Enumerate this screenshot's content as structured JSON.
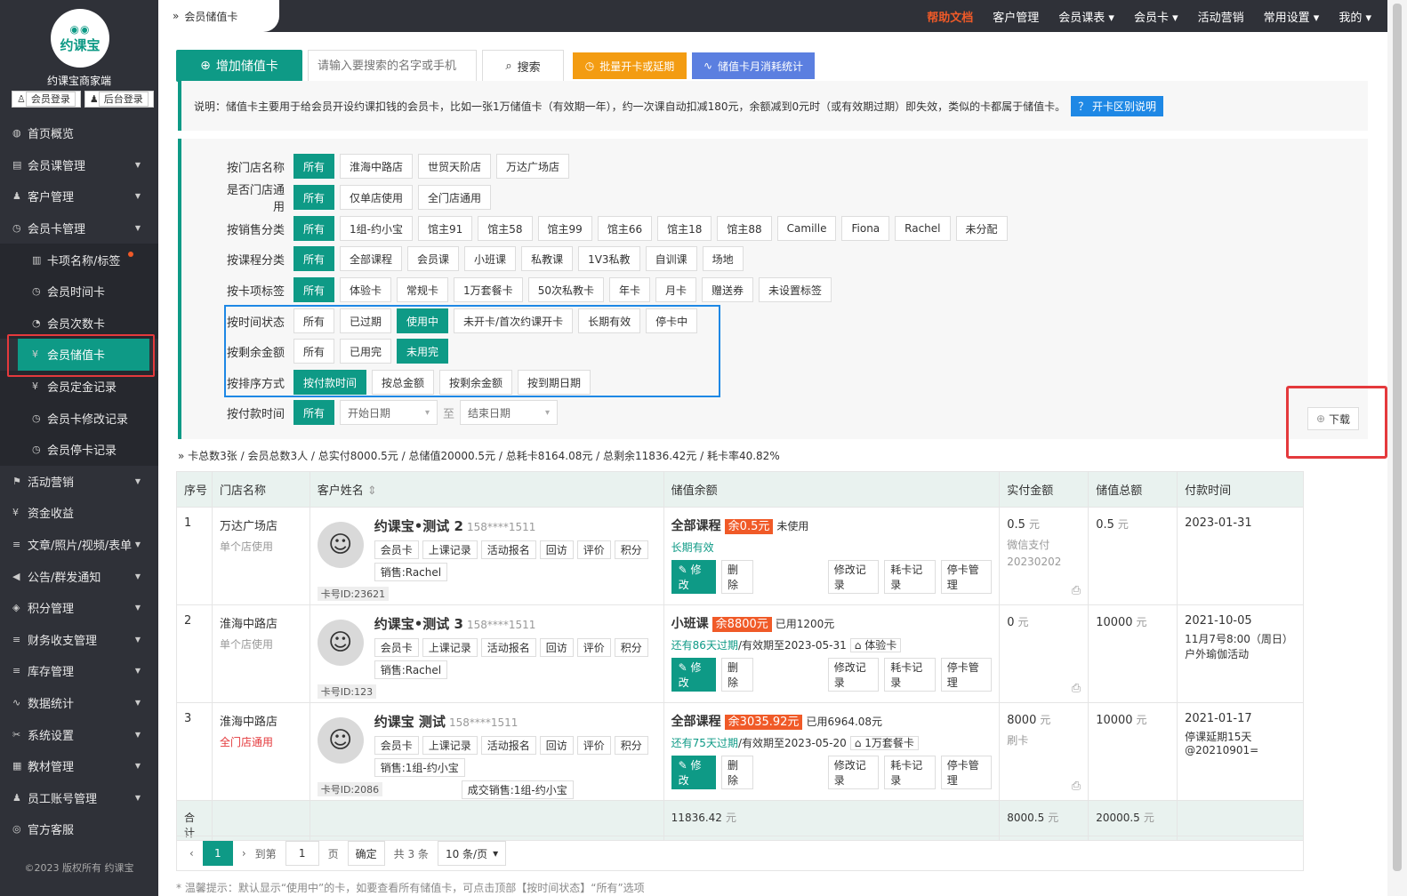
{
  "sidebar": {
    "logo": "约课宝",
    "brand": "约课宝商家端",
    "login_member": "会员登录",
    "login_admin": "后台登录",
    "items": [
      {
        "label": "首页概览",
        "icon": "◍",
        "arrow": false
      },
      {
        "label": "会员课管理",
        "icon": "▤",
        "arrow": true
      },
      {
        "label": "客户管理",
        "icon": "♟",
        "arrow": true
      },
      {
        "label": "会员卡管理",
        "icon": "◷",
        "arrow": true
      }
    ],
    "sub_items": [
      {
        "label": "卡项名称/标签",
        "icon": "▥"
      },
      {
        "label": "会员时间卡",
        "icon": "◷"
      },
      {
        "label": "会员次数卡",
        "icon": "◔"
      },
      {
        "label": "会员储值卡",
        "icon": "¥"
      },
      {
        "label": "会员定金记录",
        "icon": "¥"
      },
      {
        "label": "会员卡修改记录",
        "icon": "◷"
      },
      {
        "label": "会员停卡记录",
        "icon": "◷"
      }
    ],
    "items2": [
      {
        "label": "活动营销",
        "icon": "⚑",
        "arrow": true
      },
      {
        "label": "资金收益",
        "icon": "¥",
        "arrow": false
      },
      {
        "label": "文章/照片/视频/表单",
        "icon": "≡",
        "arrow": true
      },
      {
        "label": "公告/群发通知",
        "icon": "◀",
        "arrow": true
      },
      {
        "label": "积分管理",
        "icon": "◈",
        "arrow": true
      },
      {
        "label": "财务收支管理",
        "icon": "≡",
        "arrow": true
      },
      {
        "label": "库存管理",
        "icon": "≡",
        "arrow": true
      },
      {
        "label": "数据统计",
        "icon": "∿",
        "arrow": true
      },
      {
        "label": "系统设置",
        "icon": "✂",
        "arrow": true
      },
      {
        "label": "教材管理",
        "icon": "▦",
        "arrow": true
      },
      {
        "label": "员工账号管理",
        "icon": "♟",
        "arrow": true
      },
      {
        "label": "官方客服",
        "icon": "◎",
        "arrow": false
      }
    ],
    "copyright": "©2023 版权所有 约课宝"
  },
  "topbar": {
    "tab": "会员储值卡",
    "nav": [
      "帮助文档",
      "客户管理",
      "会员课表 ▾",
      "会员卡 ▾",
      "活动营销",
      "常用设置 ▾",
      "我的 ▾"
    ]
  },
  "toolbar": {
    "add": "增加储值卡",
    "search_placeholder": "请输入要搜索的名字或手机",
    "search": "搜索",
    "batch": "批量开卡或延期",
    "stats": "储值卡月消耗统计"
  },
  "notice": {
    "text": "说明：储值卡主要用于给会员开设约课扣钱的会员卡，比如一张1万储值卡（有效期一年），约一次课自动扣减180元，余额减到0元时（或有效期过期）即失效，类似的卡都属于储值卡。",
    "button": "开卡区别说明"
  },
  "filters": [
    {
      "label": "按门店名称",
      "tags": [
        "所有",
        "淮海中路店",
        "世贸天阶店",
        "万达广场店"
      ],
      "active": 0
    },
    {
      "label": "是否门店通用",
      "tags": [
        "所有",
        "仅单店使用",
        "全门店通用"
      ],
      "active": 0
    },
    {
      "label": "按销售分类",
      "tags": [
        "所有",
        "1组-约小宝",
        "馆主91",
        "馆主58",
        "馆主99",
        "馆主66",
        "馆主18",
        "馆主88",
        "Camille",
        "Fiona",
        "Rachel",
        "未分配"
      ],
      "active": 0
    },
    {
      "label": "按课程分类",
      "tags": [
        "所有",
        "全部课程",
        "会员课",
        "小班课",
        "私教课",
        "1V3私教",
        "自训课",
        "场地"
      ],
      "active": 0
    },
    {
      "label": "按卡项标签",
      "tags": [
        "所有",
        "体验卡",
        "常规卡",
        "1万套餐卡",
        "50次私教卡",
        "年卡",
        "月卡",
        "赠送券",
        "未设置标签"
      ],
      "active": 0
    },
    {
      "label": "按时间状态",
      "tags": [
        "所有",
        "已过期",
        "使用中",
        "未开卡/首次约课开卡",
        "长期有效",
        "停卡中"
      ],
      "active": 2
    },
    {
      "label": "按剩余金额",
      "tags": [
        "所有",
        "已用完",
        "未用完"
      ],
      "active": 2
    },
    {
      "label": "按排序方式",
      "tags": [
        "按付款时间",
        "按总金额",
        "按剩余金额",
        "按到期日期"
      ],
      "active": 0
    }
  ],
  "pay_time": {
    "label": "按付款时间",
    "all": "所有",
    "start": "开始日期",
    "to": "至",
    "end": "结束日期"
  },
  "download": "下载",
  "summary": "卡总数3张 / 会员总数3人 / 总实付8000.5元 / 总储值20000.5元 / 总耗卡8164.08元 / 总剩余11836.42元 / 耗卡率40.82%",
  "table": {
    "headers": [
      "序号",
      "门店名称",
      "客户姓名",
      "储值余额",
      "实付金额",
      "储值总额",
      "付款时间"
    ],
    "rows": [
      {
        "no": "1",
        "store": "万达广场店",
        "scope": "单个店使用",
        "scope_red": false,
        "name": "约课宝•测试 2",
        "phone": "158****1511",
        "tags": [
          "会员卡",
          "上课记录",
          "活动报名",
          "回访",
          "评价",
          "积分"
        ],
        "sales": "销售:Rachel",
        "extra_sales": "",
        "card_id": "卡号ID:23621",
        "course": "全部课程",
        "balance": "余0.5元",
        "used": "未使用",
        "validity_green": "长期有效",
        "validity_rest": "",
        "badge": "",
        "paid": "0.5",
        "paid_unit": "元",
        "paid_note": "微信支付",
        "paid_note2": "20230202",
        "total": "0.5",
        "total_unit": "元",
        "date": "2023-01-31",
        "date_note": ""
      },
      {
        "no": "2",
        "store": "淮海中路店",
        "scope": "单个店使用",
        "scope_red": false,
        "name": "约课宝•测试 3",
        "phone": "158****1511",
        "tags": [
          "会员卡",
          "上课记录",
          "活动报名",
          "回访",
          "评价",
          "积分"
        ],
        "sales": "销售:Rachel",
        "extra_sales": "",
        "card_id": "卡号ID:123",
        "course": "小班课",
        "balance": "余8800元",
        "used": "已用1200元",
        "validity_green": "还有86天过期",
        "validity_rest": "/有效期至2023-05-31",
        "badge": "体验卡",
        "paid": "0",
        "paid_unit": "元",
        "paid_note": "",
        "paid_note2": "",
        "total": "10000",
        "total_unit": "元",
        "date": "2021-10-05",
        "date_note": "11月7号8:00（周日）户外瑜伽活动"
      },
      {
        "no": "3",
        "store": "淮海中路店",
        "scope": "全门店通用",
        "scope_red": true,
        "name": "约课宝 测试",
        "phone": "158****1511",
        "tags": [
          "会员卡",
          "上课记录",
          "活动报名",
          "回访",
          "评价",
          "积分"
        ],
        "sales": "销售:1组-约小宝",
        "extra_sales": "成交销售:1组-约小宝",
        "card_id": "卡号ID:2086",
        "course": "全部课程",
        "balance": "余3035.92元",
        "used": "已用6964.08元",
        "validity_green": "还有75天过期",
        "validity_rest": "/有效期至2023-05-20",
        "badge": "1万套餐卡",
        "paid": "8000",
        "paid_unit": "元",
        "paid_note": "刷卡",
        "paid_note2": "",
        "total": "10000",
        "total_unit": "元",
        "date": "2021-01-17",
        "date_note": "停课延期15天@20210901="
      }
    ],
    "actions": [
      "修改",
      "删除",
      "修改记录",
      "耗卡记录",
      "停卡管理"
    ],
    "total_row": {
      "label": "合计",
      "balance": "11836.42",
      "paid": "8000.5",
      "total": "20000.5",
      "unit": "元"
    }
  },
  "pager": {
    "current": "1",
    "goto": "到第",
    "page_value": "1",
    "page": "页",
    "confirm": "确定",
    "count": "共 3 条",
    "per_page": "10 条/页"
  },
  "hint": "* 温馨提示：默认显示“使用中”的卡，如要查看所有储值卡，可点击顶部【按时间状态】“所有”选项"
}
